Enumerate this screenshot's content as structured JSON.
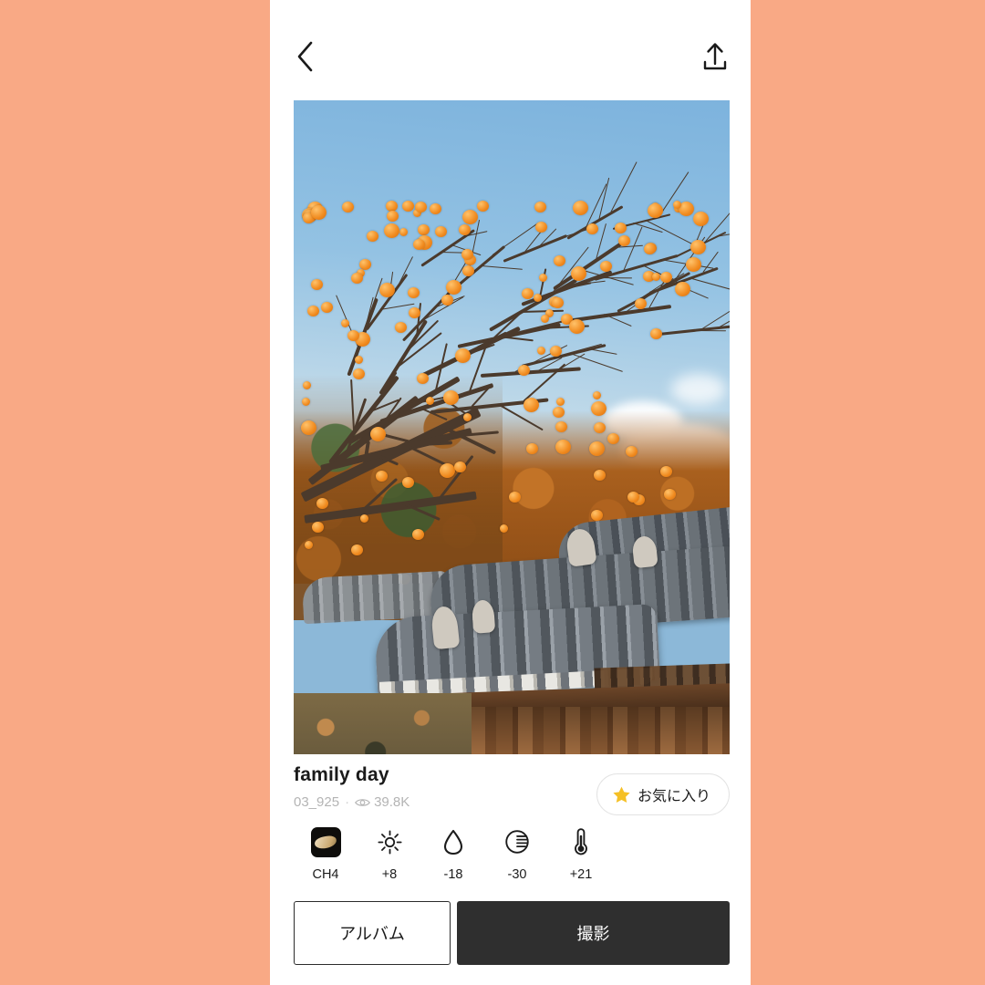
{
  "theme": {
    "background": "#f9a985",
    "panel": "#ffffff",
    "text_primary": "#1a1a1a",
    "text_muted": "#b4b4b4",
    "accent_dark": "#2f2f2f",
    "star_gold": "#f5c026"
  },
  "topbar": {
    "back_icon": "chevron-left-icon",
    "share_icon": "share-upload-icon"
  },
  "photo": {
    "alt": "persimmon-tree-over-hanok-roof",
    "scene": "Autumn persimmon tree with orange fruit above traditional Korean tiled roof and wooden wall"
  },
  "info": {
    "title": "family day",
    "author": "03_925",
    "separator": "·",
    "views_icon": "eye-icon",
    "views": "39.8K"
  },
  "favorite": {
    "icon": "star-icon",
    "label": "お気に入り"
  },
  "adjustments": [
    {
      "icon": "filter-thumbnail-icon",
      "label": "CH4"
    },
    {
      "icon": "brightness-sun-icon",
      "label": "+8"
    },
    {
      "icon": "saturation-drop-icon",
      "label": "-18"
    },
    {
      "icon": "contrast-circle-icon",
      "label": "-30"
    },
    {
      "icon": "temperature-thermometer-icon",
      "label": "+21"
    }
  ],
  "actions": {
    "album_label": "アルバム",
    "shoot_label": "撮影"
  }
}
